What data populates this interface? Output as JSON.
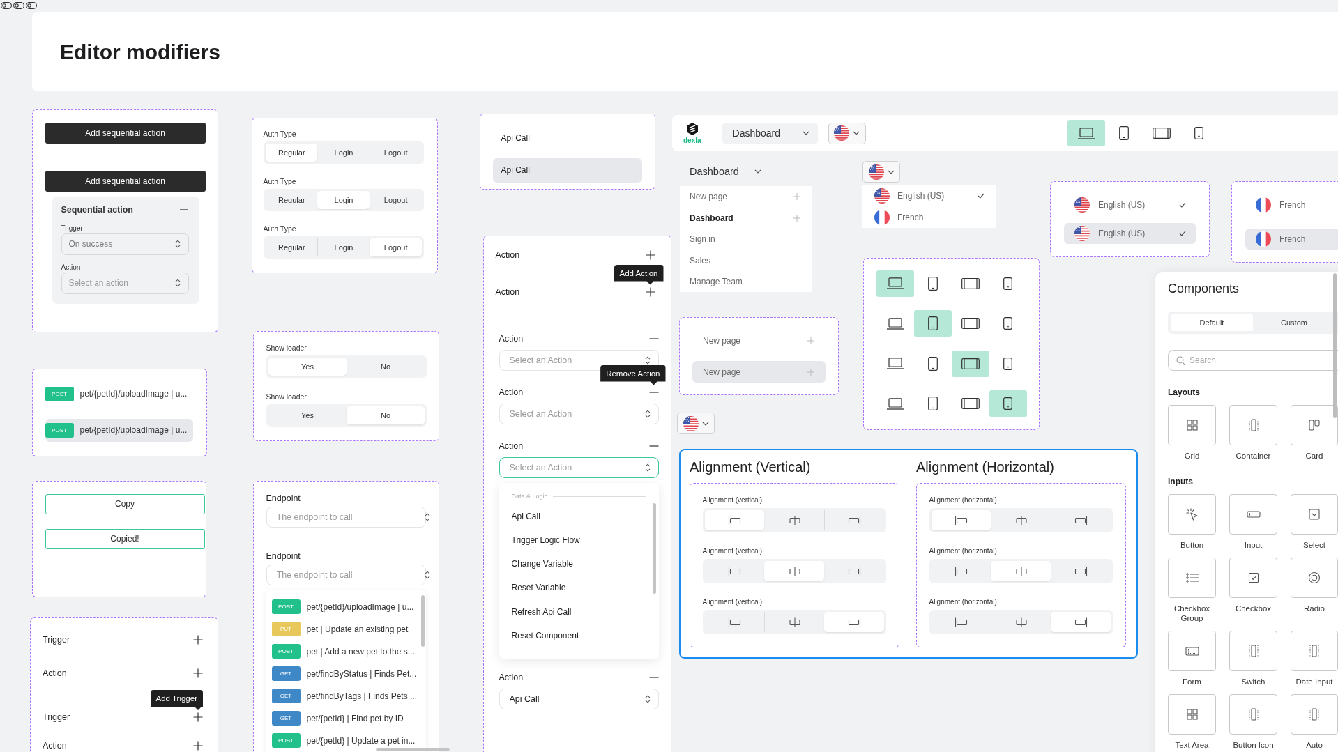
{
  "title": "Editor modifiers",
  "sequential_action": {
    "buttons": [
      "Add sequential action",
      "Add sequential action"
    ],
    "panel": {
      "title": "Sequential action",
      "fields": [
        {
          "label": "Trigger",
          "value": "On success"
        },
        {
          "label": "Action",
          "placeholder": "Select an action"
        }
      ]
    }
  },
  "endpoint_items": [
    {
      "method": "POST",
      "color": "#22c08b",
      "label": "pet/{petId}/uploadImage | u...",
      "selected": false
    },
    {
      "method": "POST",
      "color": "#22c08b",
      "label": "pet/{petId}/uploadImage | u...",
      "selected": true
    }
  ],
  "copy_buttons": [
    "Copy",
    "Copied!"
  ],
  "trigger_list": [
    {
      "label": "Trigger"
    },
    {
      "label": "Action"
    },
    {
      "label": "Trigger",
      "tooltip": "Add Trigger"
    },
    {
      "label": "Action"
    }
  ],
  "auth_type_controls": [
    {
      "label": "Auth Type",
      "options": [
        {
          "label": "Regular",
          "selected": true
        },
        {
          "label": "Login",
          "selected": false
        },
        {
          "label": "Logout",
          "selected": false
        }
      ]
    },
    {
      "label": "Auth Type",
      "options": [
        {
          "label": "Regular",
          "selected": false
        },
        {
          "label": "Login",
          "selected": true
        },
        {
          "label": "Logout",
          "selected": false
        }
      ]
    },
    {
      "label": "Auth Type",
      "options": [
        {
          "label": "Regular",
          "selected": false
        },
        {
          "label": "Login",
          "selected": false
        },
        {
          "label": "Logout",
          "selected": true
        }
      ]
    }
  ],
  "show_loader_controls": [
    {
      "label": "Show loader",
      "options": [
        {
          "label": "Yes",
          "selected": true
        },
        {
          "label": "No",
          "selected": false
        }
      ]
    },
    {
      "label": "Show loader",
      "options": [
        {
          "label": "Yes",
          "selected": false
        },
        {
          "label": "No",
          "selected": true
        }
      ]
    }
  ],
  "endpoint_selects": [
    {
      "label": "Endpoint",
      "placeholder": "The endpoint to call"
    },
    {
      "label": "Endpoint",
      "placeholder": "The endpoint to call",
      "options": [
        {
          "method": "POST",
          "color": "#22c08b",
          "label": "pet/{petId}/uploadImage | u..."
        },
        {
          "method": "PUT",
          "color": "#e9c85b",
          "label": "pet | Update an existing pet"
        },
        {
          "method": "POST",
          "color": "#22c08b",
          "label": "pet | Add a new pet to the s..."
        },
        {
          "method": "GET",
          "color": "#3e88c8",
          "label": "pet/findByStatus | Finds Pet..."
        },
        {
          "method": "GET",
          "color": "#3e88c8",
          "label": "pet/findByTags | Finds Pets ..."
        },
        {
          "method": "GET",
          "color": "#3e88c8",
          "label": "pet/{petId} | Find pet by ID"
        },
        {
          "method": "POST",
          "color": "#22c08b",
          "label": "pet/{petId} | Update a pet in..."
        }
      ]
    }
  ],
  "api_call_items": [
    {
      "label": "Api Call",
      "selected": false
    },
    {
      "label": "Api Call",
      "selected": true
    }
  ],
  "action_rows": [
    {
      "kind": "add",
      "label": "Action"
    },
    {
      "kind": "add",
      "label": "Action",
      "tooltip": "Add Action"
    },
    {
      "kind": "remove",
      "label": "Action",
      "select": {
        "placeholder": "Select an Action",
        "focused": false
      }
    },
    {
      "kind": "remove",
      "label": "Action",
      "tooltip": "Remove Action",
      "select": {
        "placeholder": "Select an Action",
        "focused": false
      }
    },
    {
      "kind": "remove",
      "label": "Action",
      "select": {
        "placeholder": "Select an Action",
        "focused": true,
        "dropdown": {
          "group": "Data & Logic",
          "items": [
            "Api Call",
            "Trigger Logic Flow",
            "Change Variable",
            "Reset Variable",
            "Refresh Api Call",
            "Reset Component"
          ]
        }
      }
    },
    {
      "kind": "remove",
      "label": "Action",
      "select": {
        "value": "Api Call",
        "focused": false
      }
    }
  ],
  "navbar": {
    "logo": "dexla",
    "page_select": "Dashboard",
    "devices": [
      {
        "kind": "desktop",
        "selected": true
      },
      {
        "kind": "tablet",
        "selected": false
      },
      {
        "kind": "landscape",
        "selected": false
      },
      {
        "kind": "mobile",
        "selected": false
      }
    ]
  },
  "page_menu": {
    "label": "Dashboard",
    "items": [
      {
        "label": "New page",
        "selected": false,
        "add": true
      },
      {
        "label": "Dashboard",
        "selected": true,
        "add": true
      },
      {
        "label": "Sign in",
        "selected": false,
        "add": false
      },
      {
        "label": "Sales",
        "selected": false,
        "add": false
      },
      {
        "label": "Manage Team",
        "selected": false,
        "add": false
      }
    ]
  },
  "language_menu": {
    "items": [
      {
        "kind": "us",
        "label": "English (US)",
        "checked": true
      },
      {
        "kind": "fr",
        "label": "French",
        "checked": false
      }
    ]
  },
  "language_frames": [
    {
      "items": [
        {
          "kind": "us",
          "label": "English (US)",
          "checked": true,
          "selected": false
        },
        {
          "kind": "us",
          "label": "English (US)",
          "checked": true,
          "selected": true
        }
      ]
    },
    {
      "items": [
        {
          "kind": "fr",
          "label": "French",
          "selected": false
        },
        {
          "kind": "fr",
          "label": "French",
          "selected": true
        }
      ]
    }
  ],
  "new_page_items": [
    {
      "label": "New page",
      "selected": false
    },
    {
      "label": "New page",
      "selected": true
    }
  ],
  "device_grid": [
    {
      "options": [
        {
          "kind": "desktop",
          "selected": true
        },
        {
          "kind": "tablet",
          "selected": false
        },
        {
          "kind": "landscape",
          "selected": false
        },
        {
          "kind": "mobile",
          "selected": false
        }
      ]
    },
    {
      "options": [
        {
          "kind": "desktop",
          "selected": false
        },
        {
          "kind": "tablet",
          "selected": true
        },
        {
          "kind": "landscape",
          "selected": false
        },
        {
          "kind": "mobile",
          "selected": false
        }
      ]
    },
    {
      "options": [
        {
          "kind": "desktop",
          "selected": false
        },
        {
          "kind": "tablet",
          "selected": false
        },
        {
          "kind": "landscape",
          "selected": true
        },
        {
          "kind": "mobile",
          "selected": false
        }
      ]
    },
    {
      "options": [
        {
          "kind": "desktop",
          "selected": false
        },
        {
          "kind": "tablet",
          "selected": false
        },
        {
          "kind": "landscape",
          "selected": false
        },
        {
          "kind": "mobile",
          "selected": true
        }
      ]
    }
  ],
  "alignment_panel": {
    "groups": [
      {
        "title": "Alignment (Vertical)",
        "controls": [
          {
            "label": "Alignment (vertical)",
            "options": [
              {
                "kind": "start",
                "selected": true
              },
              {
                "kind": "center",
                "selected": false
              },
              {
                "kind": "end",
                "selected": false
              }
            ]
          },
          {
            "label": "Alignment (vertical)",
            "options": [
              {
                "kind": "start",
                "selected": false
              },
              {
                "kind": "center",
                "selected": true
              },
              {
                "kind": "end",
                "selected": false
              }
            ]
          },
          {
            "label": "Alignment (vertical)",
            "options": [
              {
                "kind": "start",
                "selected": false
              },
              {
                "kind": "center",
                "selected": false
              },
              {
                "kind": "end",
                "selected": true
              }
            ]
          }
        ]
      },
      {
        "title": "Alignment (Horizontal)",
        "controls": [
          {
            "label": "Alignment (horizontal)",
            "options": [
              {
                "kind": "start",
                "selected": true
              },
              {
                "kind": "center",
                "selected": false
              },
              {
                "kind": "end",
                "selected": false
              }
            ]
          },
          {
            "label": "Alignment (horizontal)",
            "options": [
              {
                "kind": "start",
                "selected": false
              },
              {
                "kind": "center",
                "selected": true
              },
              {
                "kind": "end",
                "selected": false
              }
            ]
          },
          {
            "label": "Alignment (horizontal)",
            "options": [
              {
                "kind": "start",
                "selected": false
              },
              {
                "kind": "center",
                "selected": false
              },
              {
                "kind": "end",
                "selected": true
              }
            ]
          }
        ]
      }
    ]
  },
  "components_panel": {
    "title": "Components",
    "tabs": [
      {
        "label": "Default",
        "selected": true
      },
      {
        "label": "Custom",
        "selected": false
      }
    ],
    "search": {
      "placeholder": "Search"
    },
    "sections": [
      {
        "title": "Layouts",
        "items": [
          {
            "kind": "grid",
            "label": "Grid"
          },
          {
            "kind": "container",
            "label": "Container"
          },
          {
            "kind": "card",
            "label": "Card"
          }
        ]
      },
      {
        "title": "Inputs",
        "items": [
          {
            "kind": "button",
            "label": "Button"
          },
          {
            "kind": "input",
            "label": "Input"
          },
          {
            "kind": "select",
            "label": "Select"
          },
          {
            "kind": "checkbox_group",
            "label": "Checkbox Group"
          },
          {
            "kind": "checkbox",
            "label": "Checkbox"
          },
          {
            "kind": "radio",
            "label": "Radio"
          },
          {
            "kind": "form",
            "label": "Form"
          },
          {
            "kind": "switch",
            "label": "Switch"
          },
          {
            "kind": "date_input",
            "label": "Date Input"
          },
          {
            "kind": "text_area",
            "label": "Text Area"
          },
          {
            "kind": "button_icon",
            "label": "Button Icon"
          },
          {
            "kind": "autocomplete",
            "label": "Auto"
          }
        ]
      }
    ]
  }
}
